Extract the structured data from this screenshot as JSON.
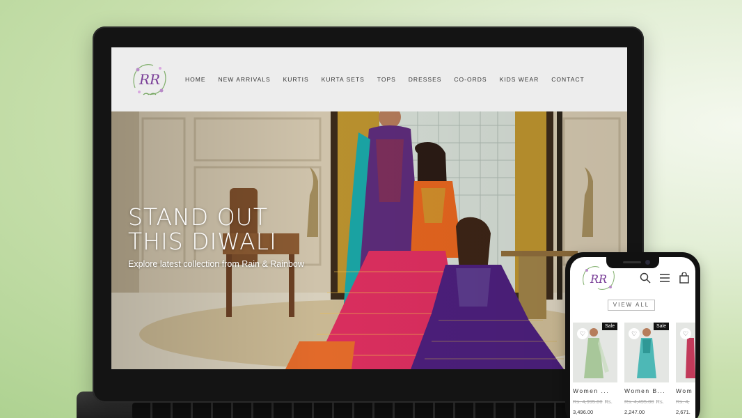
{
  "brand": {
    "logo_text": "RR"
  },
  "nav": {
    "items": [
      "HOME",
      "NEW ARRIVALS",
      "KURTIS",
      "KURTA SETS",
      "TOPS",
      "DRESSES",
      "CO-ORDS",
      "KIDS WEAR",
      "CONTACT"
    ]
  },
  "hero": {
    "title_line1": "STAND OUT",
    "title_line2": "THIS DIWALI",
    "subtitle": "Explore latest collection from Rain & Rainbow"
  },
  "mobile": {
    "view_all": "VIEW ALL",
    "products": [
      {
        "name": "Women ...",
        "badge": "Sale",
        "old_price": "Rs. 4,995.00",
        "currency": "Rs.",
        "price": "3,496.00"
      },
      {
        "name": "Women B...",
        "badge": "Sale",
        "old_price": "Rs. 4,495.00",
        "currency": "Rs.",
        "price": "2,247.00"
      },
      {
        "name": "Wom",
        "badge": "",
        "old_price": "Rs. 4,",
        "currency": "",
        "price": "2,671."
      }
    ]
  },
  "colors": {
    "background": "#c9e0ae",
    "header_bg": "#ededed",
    "text_dark": "#333333"
  }
}
